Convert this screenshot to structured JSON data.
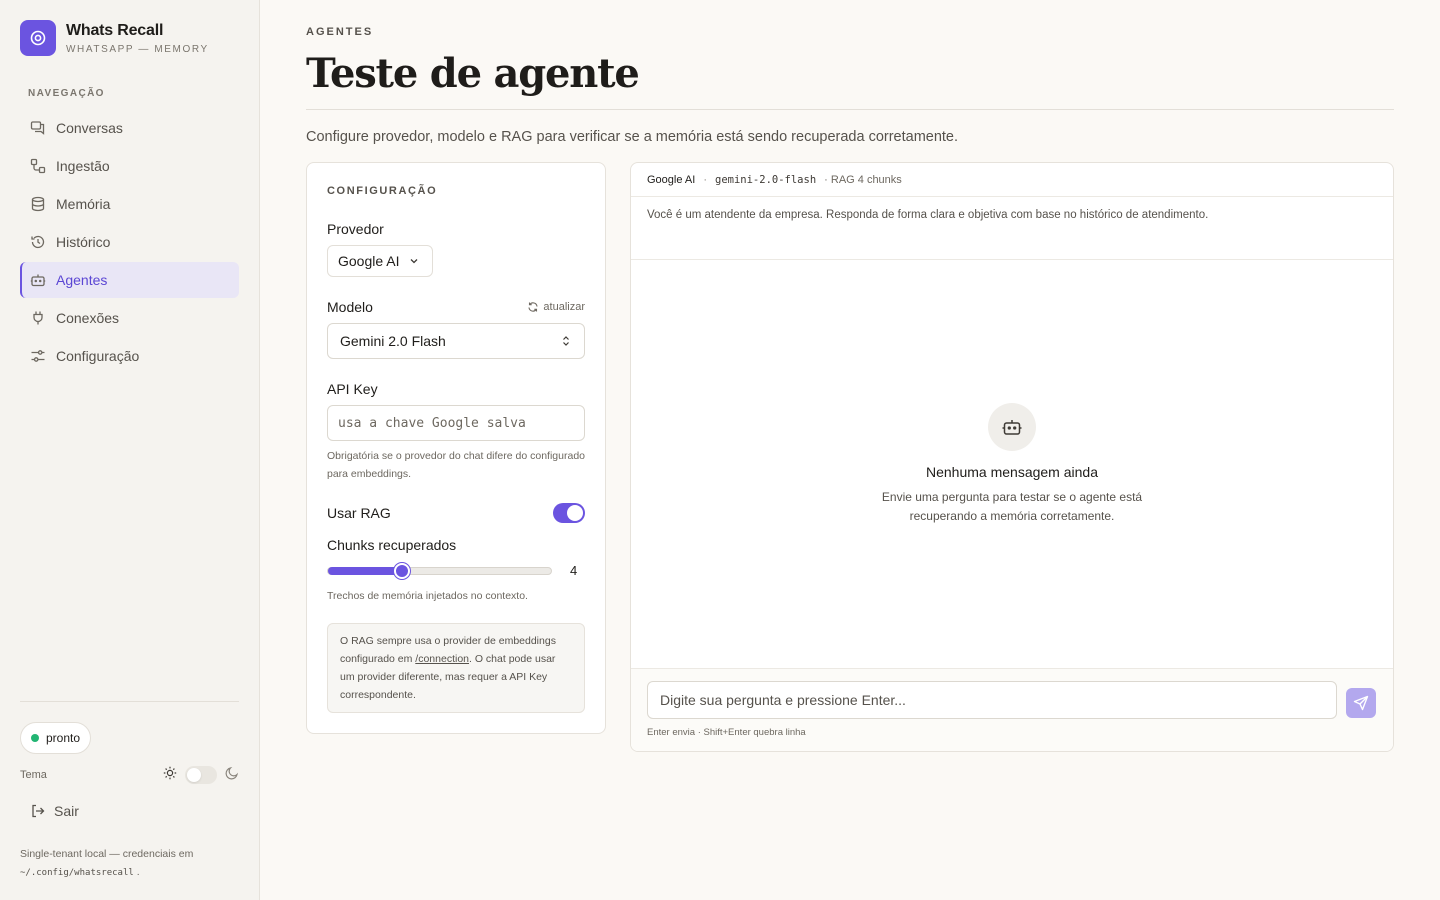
{
  "brand": {
    "name": "Whats Recall",
    "subtitle": "WHATSAPP — MEMORY"
  },
  "sidebar": {
    "heading": "NAVEGAÇÃO",
    "items": [
      {
        "label": "Conversas",
        "icon": "chat-icon"
      },
      {
        "label": "Ingestão",
        "icon": "ingest-icon"
      },
      {
        "label": "Memória",
        "icon": "database-icon"
      },
      {
        "label": "Histórico",
        "icon": "history-icon"
      },
      {
        "label": "Agentes",
        "icon": "bot-icon",
        "active": true
      },
      {
        "label": "Conexões",
        "icon": "plug-icon"
      },
      {
        "label": "Configuração",
        "icon": "settings-icon"
      }
    ],
    "status": "pronto",
    "theme_label": "Tema",
    "logout": "Sair",
    "footnote_text": "Single-tenant local — credenciais em",
    "footnote_path": "~/.config/whatsrecall",
    "footnote_end": "."
  },
  "page": {
    "eyebrow": "AGENTES",
    "title": "Teste de agente",
    "description": "Configure provedor, modelo e RAG para verificar se a memória está sendo recuperada corretamente."
  },
  "config": {
    "heading": "CONFIGURAÇÃO",
    "provider_label": "Provedor",
    "provider_value": "Google AI",
    "model_label": "Modelo",
    "refresh_label": "atualizar",
    "model_value": "Gemini 2.0 Flash",
    "api_key_label": "API Key",
    "api_key_placeholder": "usa a chave Google salva",
    "api_key_help": "Obrigatória se o provedor do chat difere do configurado para embeddings.",
    "rag_label": "Usar RAG",
    "rag_enabled": true,
    "chunks_label": "Chunks recuperados",
    "chunks_value": "4",
    "chunks_min": 1,
    "chunks_max": 10,
    "chunks_help": "Trechos de memória injetados no contexto.",
    "note_before": "O RAG sempre usa o provider de embeddings configurado em ",
    "note_link": "/connection",
    "note_after": ". O chat pode usar um provider diferente, mas requer a API Key correspondente."
  },
  "chat": {
    "provider": "Google AI",
    "separator": "·",
    "model": "gemini-2.0-flash",
    "rag_info": "· RAG 4 chunks",
    "system_prompt": "Você é um atendente da empresa. Responda de forma clara e objetiva com base no histórico de atendimento.",
    "empty_title": "Nenhuma mensagem ainda",
    "empty_desc": "Envie uma pergunta para testar se o agente está recuperando a memória corretamente.",
    "input_placeholder": "Digite sua pergunta e pressione Enter...",
    "hint": "Enter envia · Shift+Enter quebra linha"
  },
  "colors": {
    "accent": "#6b54e0",
    "status_ok": "#22b573",
    "background": "#fbf9f5"
  }
}
